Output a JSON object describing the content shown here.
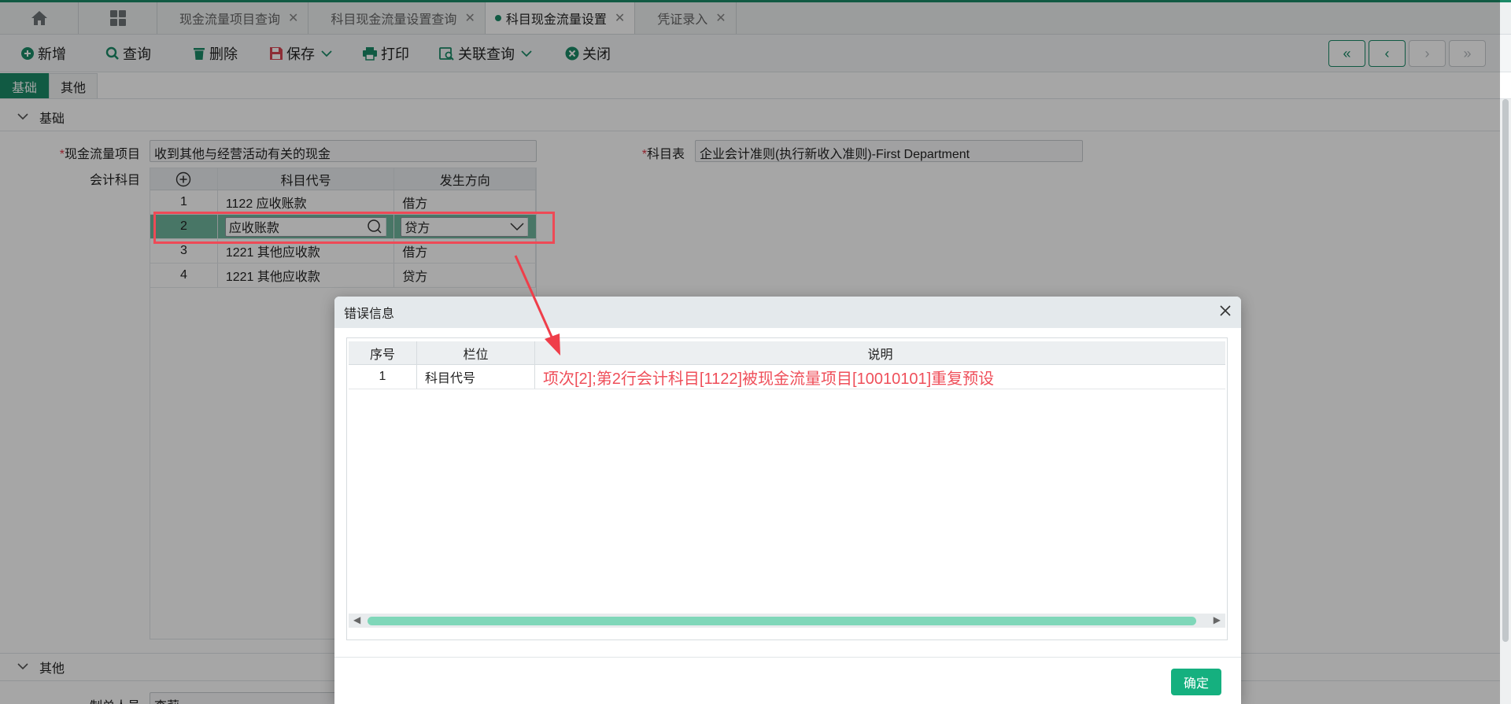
{
  "tabs": [
    {
      "label": "现金流量项目查询",
      "active": false
    },
    {
      "label": "科目现金流量设置查询",
      "active": false
    },
    {
      "label": "科目现金流量设置",
      "active": true
    },
    {
      "label": "凭证录入",
      "active": false
    }
  ],
  "tab_close": "✕",
  "toolbar": {
    "new": "新增",
    "query": "查询",
    "delete": "删除",
    "save": "保存",
    "print": "打印",
    "related_query": "关联查询",
    "close": "关闭"
  },
  "subtabs": {
    "basic": "基础",
    "other": "其他"
  },
  "sections": {
    "basic": "基础",
    "other": "其他"
  },
  "form": {
    "cash_flow_item_label": "现金流量项目",
    "cash_flow_item_value": "收到其他与经营活动有关的现金",
    "chart_label": "科目表",
    "chart_value": "企业会计准则(执行新收入准则)-First Department",
    "accounts_label": "会计科目",
    "preparer_label": "制单人员",
    "preparer_value": "李莉",
    "required_mark": "*"
  },
  "accounts_grid": {
    "headers": {
      "code": "科目代号",
      "direction": "发生方向"
    },
    "rows": [
      {
        "no": "1",
        "code": "1122 应收账款",
        "direction": "借方"
      },
      {
        "no": "2",
        "code": "应收账款",
        "direction": "贷方"
      },
      {
        "no": "3",
        "code": "1221 其他应收款",
        "direction": "借方"
      },
      {
        "no": "4",
        "code": "1221 其他应收款",
        "direction": "贷方"
      }
    ]
  },
  "dialog": {
    "title": "错误信息",
    "headers": {
      "no": "序号",
      "field": "栏位",
      "desc": "说明"
    },
    "rows": [
      {
        "no": "1",
        "field": "科目代号",
        "desc": "项次[2];第2行会计科目[1122]被现金流量项目[10010101]重复预设"
      }
    ],
    "ok": "确定"
  },
  "colors": {
    "accent": "#1b8a68",
    "error": "#ef4f5a",
    "ok": "#15b07f",
    "highlight": "#ee4a56"
  }
}
